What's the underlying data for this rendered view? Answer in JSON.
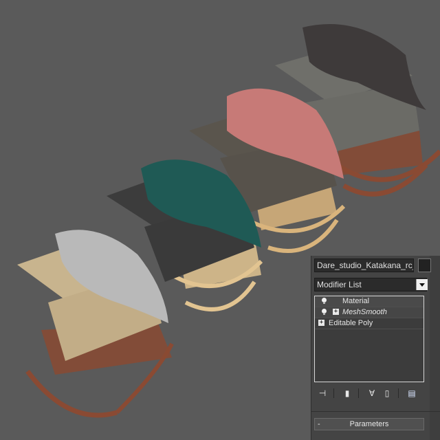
{
  "viewport": {
    "background": "#5a5a5a",
    "scene_description_colors": {
      "throw_blanket_colors": [
        "#b9b9b9",
        "#1f5a55",
        "#c77a77",
        "#3e3a3a"
      ],
      "cushion_colors": [
        "#c8b48e",
        "#3c3c3c",
        "#5a554d",
        "#6f6f6a"
      ],
      "frame_colors": [
        "#8a4a33",
        "#e2c491",
        "#d9b47c",
        "#8a4a33"
      ]
    }
  },
  "modifier_panel": {
    "object_name": "Dare_studio_Katakana_rc_clo",
    "modifier_list_label": "Modifier List",
    "stack": [
      {
        "label": "Material",
        "italic": false,
        "has_bulb": true,
        "has_expand": false
      },
      {
        "label": "MeshSmooth",
        "italic": true,
        "has_bulb": true,
        "has_expand": true
      },
      {
        "label": "Editable Poly",
        "italic": false,
        "has_bulb": false,
        "has_expand": true
      }
    ],
    "toolbar_icons": [
      "pin-stack-icon",
      "show-end-result-icon",
      "make-unique-icon",
      "remove-modifier-icon",
      "configure-modifier-sets-icon"
    ],
    "rollout": {
      "toggle": "-",
      "title": "Parameters"
    }
  }
}
